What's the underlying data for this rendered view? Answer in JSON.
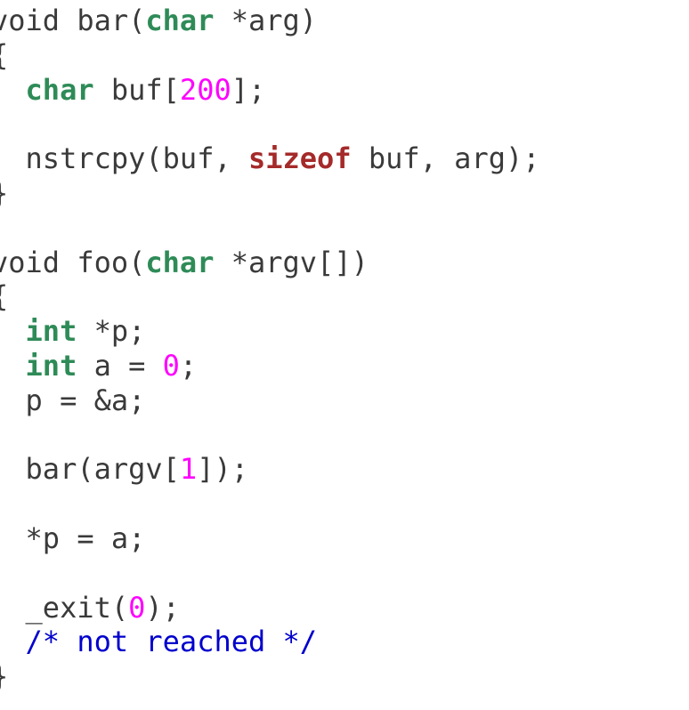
{
  "editor": {
    "language": "C",
    "colors": {
      "background": "#ffffff",
      "text": "#3a3a3a",
      "keyword": "#2e8b57",
      "sizeof": "#a52a2a",
      "number": "#ff00ff",
      "comment": "#0000cd"
    },
    "lines": [
      [
        {
          "t": "plain",
          "v": "void bar("
        },
        {
          "t": "kw",
          "v": "char"
        },
        {
          "t": "plain",
          "v": " *arg)"
        }
      ],
      [
        {
          "t": "plain",
          "v": "{"
        }
      ],
      [
        {
          "t": "plain",
          "v": "  "
        },
        {
          "t": "kw",
          "v": "char"
        },
        {
          "t": "plain",
          "v": " buf["
        },
        {
          "t": "num",
          "v": "200"
        },
        {
          "t": "plain",
          "v": "];"
        }
      ],
      [],
      [
        {
          "t": "plain",
          "v": "  nstrcpy(buf, "
        },
        {
          "t": "sizeof",
          "v": "sizeof"
        },
        {
          "t": "plain",
          "v": " buf, arg);"
        }
      ],
      [
        {
          "t": "plain",
          "v": "}"
        }
      ],
      [],
      [
        {
          "t": "plain",
          "v": "void foo("
        },
        {
          "t": "kw",
          "v": "char"
        },
        {
          "t": "plain",
          "v": " *argv[])"
        }
      ],
      [
        {
          "t": "plain",
          "v": "{"
        }
      ],
      [
        {
          "t": "plain",
          "v": "  "
        },
        {
          "t": "kw",
          "v": "int"
        },
        {
          "t": "plain",
          "v": " *p;"
        }
      ],
      [
        {
          "t": "plain",
          "v": "  "
        },
        {
          "t": "kw",
          "v": "int"
        },
        {
          "t": "plain",
          "v": " a = "
        },
        {
          "t": "num",
          "v": "0"
        },
        {
          "t": "plain",
          "v": ";"
        }
      ],
      [
        {
          "t": "plain",
          "v": "  p = &a;"
        }
      ],
      [],
      [
        {
          "t": "plain",
          "v": "  bar(argv["
        },
        {
          "t": "num",
          "v": "1"
        },
        {
          "t": "plain",
          "v": "]);"
        }
      ],
      [],
      [
        {
          "t": "plain",
          "v": "  *p = a;"
        }
      ],
      [],
      [
        {
          "t": "plain",
          "v": "  _exit("
        },
        {
          "t": "num",
          "v": "0"
        },
        {
          "t": "plain",
          "v": ");"
        }
      ],
      [
        {
          "t": "plain",
          "v": "  "
        },
        {
          "t": "comment",
          "v": "/* not reached */"
        }
      ],
      [
        {
          "t": "plain",
          "v": "}"
        }
      ]
    ]
  }
}
